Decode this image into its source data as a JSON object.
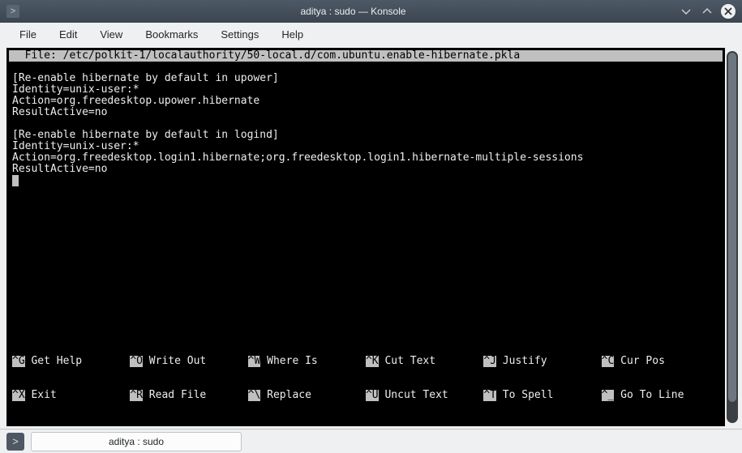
{
  "window": {
    "title": "aditya : sudo — Konsole",
    "icon_glyph": ">"
  },
  "menubar": {
    "items": [
      "File",
      "Edit",
      "View",
      "Bookmarks",
      "Settings",
      "Help"
    ]
  },
  "nano": {
    "header_prefix": "  File: ",
    "header_path": "/etc/polkit-1/localauthority/50-local.d/com.ubuntu.enable-hibernate.pkla",
    "body_lines": [
      "",
      "[Re-enable hibernate by default in upower]",
      "Identity=unix-user:*",
      "Action=org.freedesktop.upower.hibernate",
      "ResultActive=no",
      "",
      "[Re-enable hibernate by default in logind]",
      "Identity=unix-user:*",
      "Action=org.freedesktop.login1.hibernate;org.freedesktop.login1.hibernate-multiple-sessions",
      "ResultActive=no"
    ],
    "shortcuts": {
      "row1": [
        {
          "key": "^G",
          "label": "Get Help"
        },
        {
          "key": "^O",
          "label": "Write Out"
        },
        {
          "key": "^W",
          "label": "Where Is"
        },
        {
          "key": "^K",
          "label": "Cut Text"
        },
        {
          "key": "^J",
          "label": "Justify"
        },
        {
          "key": "^C",
          "label": "Cur Pos"
        }
      ],
      "row2": [
        {
          "key": "^X",
          "label": "Exit"
        },
        {
          "key": "^R",
          "label": "Read File"
        },
        {
          "key": "^\\",
          "label": "Replace"
        },
        {
          "key": "^U",
          "label": "Uncut Text"
        },
        {
          "key": "^T",
          "label": "To Spell"
        },
        {
          "key": "^_",
          "label": "Go To Line"
        }
      ]
    }
  },
  "tabbar": {
    "newtab_glyph": ">",
    "tab_label": "aditya : sudo"
  }
}
